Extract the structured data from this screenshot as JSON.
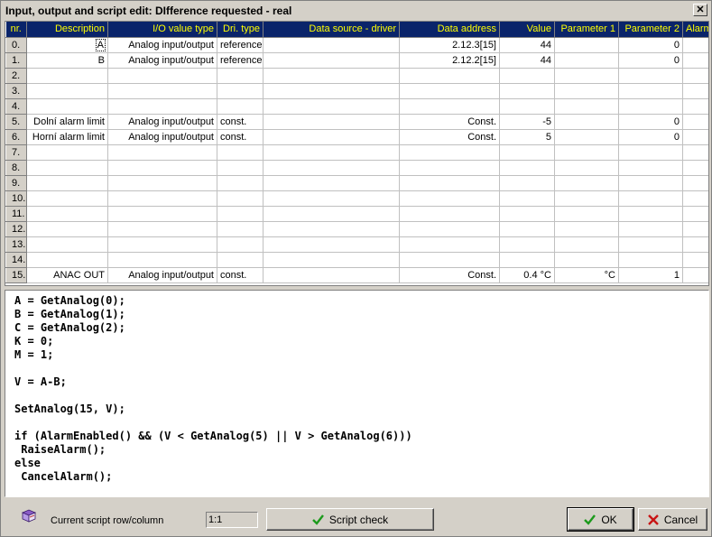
{
  "window": {
    "title": "Input, output and script edit: DIfference requested - real",
    "close_glyph": "✕"
  },
  "grid": {
    "columns": [
      "nr.",
      "Description",
      "I/O value type",
      "Dri. type",
      "Data source - driver",
      "Data address",
      "Value",
      "Parameter 1",
      "Parameter 2",
      "Alarm"
    ],
    "rows": [
      {
        "nr": "0.",
        "desc": "A",
        "iotype": "Analog input/output",
        "drv": "reference",
        "src": "",
        "addr": "2.12.3[15]",
        "val": "44",
        "p1": "",
        "p2": "0",
        "alarm": ""
      },
      {
        "nr": "1.",
        "desc": "B",
        "iotype": "Analog input/output",
        "drv": "reference",
        "src": "",
        "addr": "2.12.2[15]",
        "val": "44",
        "p1": "",
        "p2": "0",
        "alarm": ""
      },
      {
        "nr": "2.",
        "desc": "",
        "iotype": "",
        "drv": "",
        "src": "",
        "addr": "",
        "val": "",
        "p1": "",
        "p2": "",
        "alarm": ""
      },
      {
        "nr": "3.",
        "desc": "",
        "iotype": "",
        "drv": "",
        "src": "",
        "addr": "",
        "val": "",
        "p1": "",
        "p2": "",
        "alarm": ""
      },
      {
        "nr": "4.",
        "desc": "",
        "iotype": "",
        "drv": "",
        "src": "",
        "addr": "",
        "val": "",
        "p1": "",
        "p2": "",
        "alarm": ""
      },
      {
        "nr": "5.",
        "desc": "Dolní alarm limit",
        "iotype": "Analog input/output",
        "drv": "const.",
        "src": "",
        "addr": "Const.",
        "val": "-5",
        "p1": "",
        "p2": "0",
        "alarm": ""
      },
      {
        "nr": "6.",
        "desc": "Horní alarm limit",
        "iotype": "Analog input/output",
        "drv": "const.",
        "src": "",
        "addr": "Const.",
        "val": "5",
        "p1": "",
        "p2": "0",
        "alarm": ""
      },
      {
        "nr": "7.",
        "desc": "",
        "iotype": "",
        "drv": "",
        "src": "",
        "addr": "",
        "val": "",
        "p1": "",
        "p2": "",
        "alarm": ""
      },
      {
        "nr": "8.",
        "desc": "",
        "iotype": "",
        "drv": "",
        "src": "",
        "addr": "",
        "val": "",
        "p1": "",
        "p2": "",
        "alarm": ""
      },
      {
        "nr": "9.",
        "desc": "",
        "iotype": "",
        "drv": "",
        "src": "",
        "addr": "",
        "val": "",
        "p1": "",
        "p2": "",
        "alarm": ""
      },
      {
        "nr": "10.",
        "desc": "",
        "iotype": "",
        "drv": "",
        "src": "",
        "addr": "",
        "val": "",
        "p1": "",
        "p2": "",
        "alarm": ""
      },
      {
        "nr": "11.",
        "desc": "",
        "iotype": "",
        "drv": "",
        "src": "",
        "addr": "",
        "val": "",
        "p1": "",
        "p2": "",
        "alarm": ""
      },
      {
        "nr": "12.",
        "desc": "",
        "iotype": "",
        "drv": "",
        "src": "",
        "addr": "",
        "val": "",
        "p1": "",
        "p2": "",
        "alarm": ""
      },
      {
        "nr": "13.",
        "desc": "",
        "iotype": "",
        "drv": "",
        "src": "",
        "addr": "",
        "val": "",
        "p1": "",
        "p2": "",
        "alarm": ""
      },
      {
        "nr": "14.",
        "desc": "",
        "iotype": "",
        "drv": "",
        "src": "",
        "addr": "",
        "val": "",
        "p1": "",
        "p2": "",
        "alarm": ""
      },
      {
        "nr": "15.",
        "desc": "ANAC OUT",
        "iotype": "Analog input/output",
        "drv": "const.",
        "src": "",
        "addr": "Const.",
        "val": "0.4 °C",
        "p1": "°C",
        "p2": "1",
        "alarm": ""
      }
    ]
  },
  "script": {
    "lines": [
      "A = GetAnalog(0);",
      "B = GetAnalog(1);",
      "C = GetAnalog(2);",
      "K = 0;",
      "M = 1;",
      "",
      "V = A-B;",
      "",
      "SetAnalog(15, V);",
      "",
      "if (AlarmEnabled() && (V < GetAnalog(5) || V > GetAnalog(6)))",
      " RaiseAlarm();",
      "else",
      " CancelAlarm();"
    ]
  },
  "footer": {
    "cursor_label": "Current script row/column",
    "cursor_value": "1:1",
    "script_check_label": "Script check",
    "ok_label": "OK",
    "cancel_label": "Cancel",
    "icons": {
      "book": "book-icon",
      "check": "checkmark-icon",
      "cancel": "cross-icon"
    }
  },
  "colors": {
    "header_bg": "#0a246a",
    "header_text": "#ffff00",
    "window_bg": "#d4d0c8",
    "check_green": "#1c9a1c",
    "cancel_red": "#c81414"
  }
}
